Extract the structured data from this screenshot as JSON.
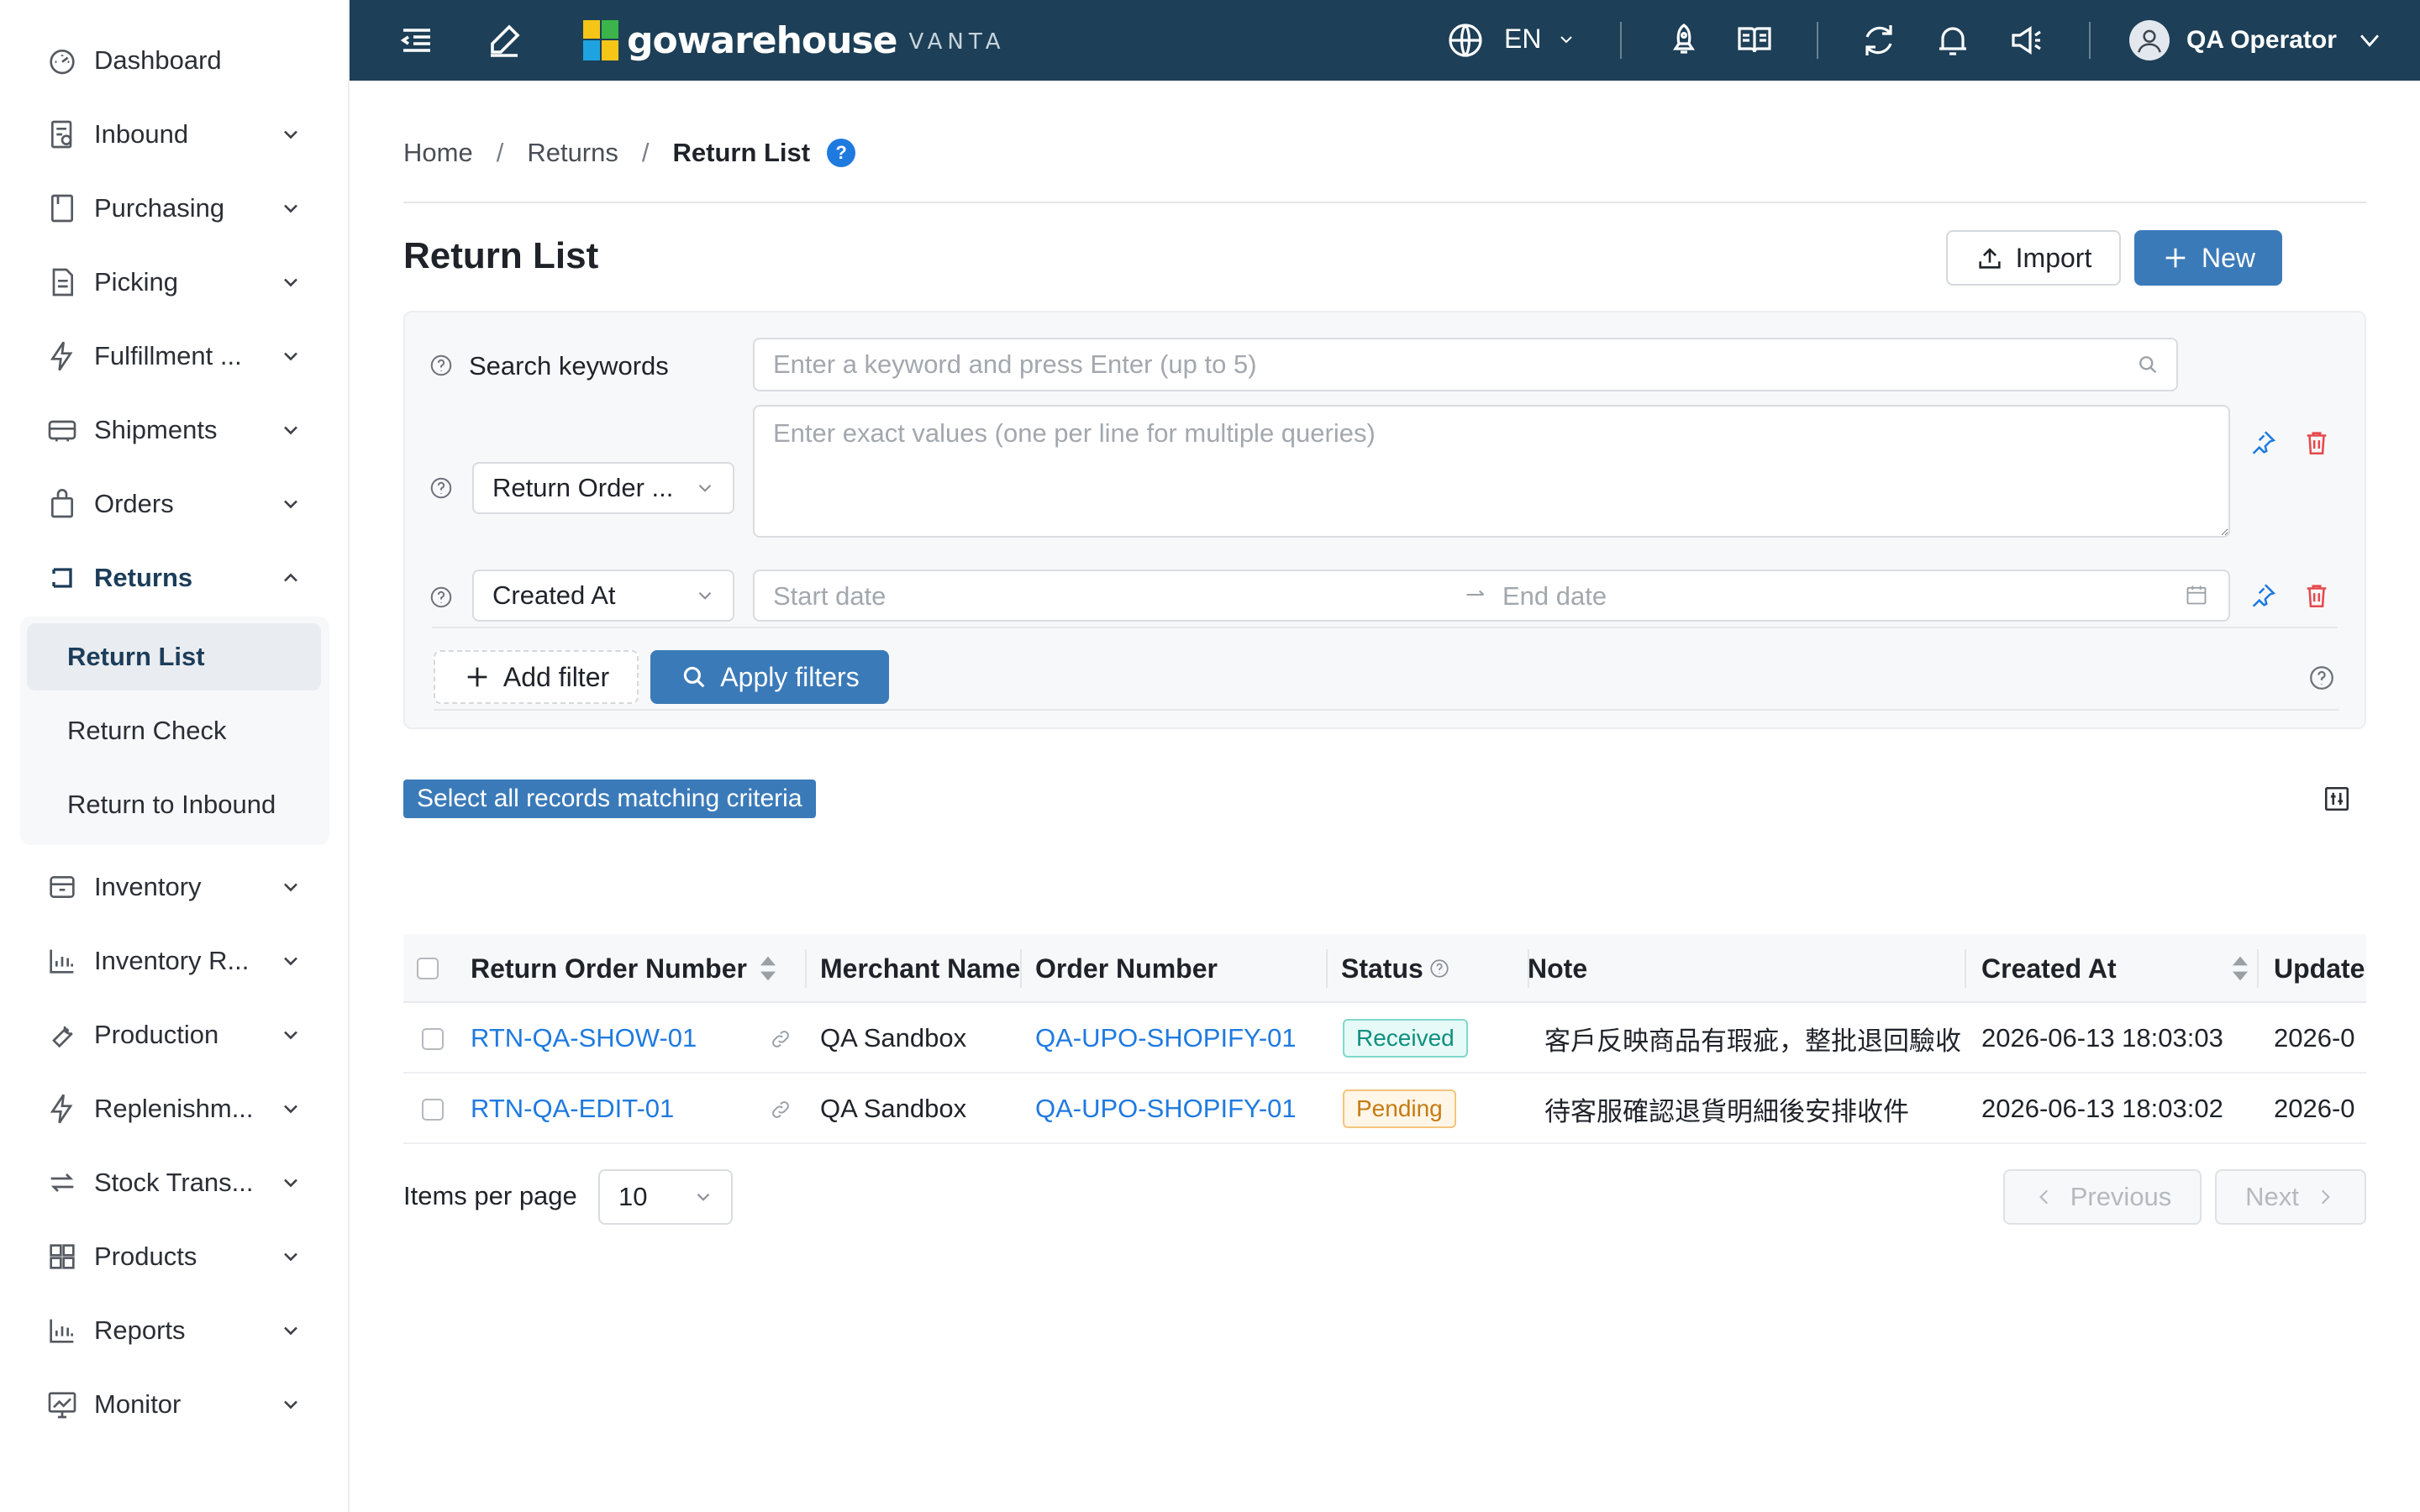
{
  "sidebar": {
    "items": [
      {
        "label": "Dashboard",
        "icon": "dashboard-icon"
      },
      {
        "label": "Inbound",
        "icon": "inbound-icon"
      },
      {
        "label": "Purchasing",
        "icon": "purchasing-icon"
      },
      {
        "label": "Picking",
        "icon": "picking-icon"
      },
      {
        "label": "Fulfillment ...",
        "icon": "lightning-icon"
      },
      {
        "label": "Shipments",
        "icon": "truck-icon"
      },
      {
        "label": "Orders",
        "icon": "bag-icon"
      },
      {
        "label": "Returns",
        "icon": "return-icon"
      },
      {
        "label": "Inventory",
        "icon": "inventory-icon"
      },
      {
        "label": "Inventory R...",
        "icon": "bar-chart-icon"
      },
      {
        "label": "Production",
        "icon": "wrench-icon"
      },
      {
        "label": "Replenishm...",
        "icon": "lightning-icon"
      },
      {
        "label": "Stock Trans...",
        "icon": "transfer-icon"
      },
      {
        "label": "Products",
        "icon": "grid-icon"
      },
      {
        "label": "Reports",
        "icon": "bar-chart-icon"
      },
      {
        "label": "Monitor",
        "icon": "monitor-icon"
      }
    ],
    "returns_sub": [
      {
        "label": "Return List"
      },
      {
        "label": "Return Check"
      },
      {
        "label": "Return to Inbound"
      }
    ]
  },
  "topbar": {
    "brand": "gowarehouse",
    "brand_sub": "VANTA",
    "language": "EN",
    "user": "QA Operator"
  },
  "breadcrumb": {
    "home": "Home",
    "section": "Returns",
    "current": "Return List",
    "help": "?"
  },
  "page": {
    "title": "Return List",
    "import_label": "Import",
    "new_label": "New"
  },
  "filters": {
    "keyword_label": "Search keywords",
    "keyword_placeholder": "Enter a keyword and press Enter (up to 5)",
    "field1_select": "Return Order ...",
    "field1_placeholder": "Enter exact values (one per line for multiple queries)",
    "field2_select": "Created At",
    "start_placeholder": "Start date",
    "end_placeholder": "End date",
    "add_filter_label": "Add filter",
    "apply_label": "Apply filters"
  },
  "select_all_label": "Select all records matching criteria",
  "table": {
    "columns": [
      "Return Order Number",
      "Merchant Name",
      "Order Number",
      "Status",
      "Note",
      "Created At",
      "Update"
    ],
    "rows": [
      {
        "return_no": "RTN-QA-SHOW-01",
        "merchant": "QA Sandbox",
        "order_no": "QA-UPO-SHOPIFY-01",
        "status": "Received",
        "note": "客戶反映商品有瑕疵，整批退回驗收",
        "created": "2026-06-13 18:03:03",
        "updated": "2026-0"
      },
      {
        "return_no": "RTN-QA-EDIT-01",
        "merchant": "QA Sandbox",
        "order_no": "QA-UPO-SHOPIFY-01",
        "status": "Pending",
        "note": "待客服確認退貨明細後安排收件",
        "created": "2026-06-13 18:03:02",
        "updated": "2026-0"
      }
    ]
  },
  "pagination": {
    "per_page_label": "Items per page",
    "per_page_value": "10",
    "prev_label": "Previous",
    "next_label": "Next"
  },
  "colors": {
    "topbar": "#1d3f57",
    "primary": "#3b7ab8",
    "link": "#1f7ae0",
    "received": "#0f8f7f",
    "pending": "#c77b10",
    "danger": "#e5484d"
  }
}
